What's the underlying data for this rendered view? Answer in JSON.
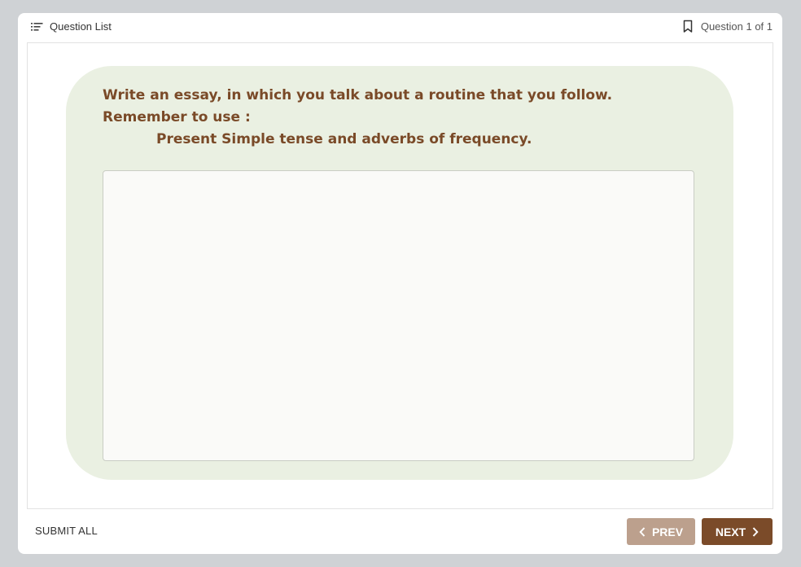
{
  "header": {
    "question_list_label": "Question List",
    "question_counter": "Question 1 of 1",
    "icons": {
      "list": "list-icon",
      "bookmark": "bookmark-icon"
    }
  },
  "question": {
    "prompt_line1": "Write an essay, in which you talk about a routine that you follow.",
    "prompt_line2": "Remember to use :",
    "prompt_line3": "Present Simple tense and adverbs of frequency.",
    "answer_value": ""
  },
  "footer": {
    "submit_all_label": "SUBMIT ALL",
    "prev_label": "PREV",
    "next_label": "NEXT"
  },
  "colors": {
    "card_background": "#eaf0e2",
    "prompt_text": "#7a4a28",
    "prev_button": "#bca08d",
    "next_button": "#7b4b29"
  }
}
